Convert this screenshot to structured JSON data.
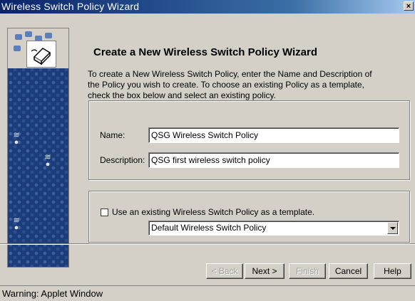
{
  "window": {
    "title": "Wireless Switch Policy Wizard",
    "close_label": "×"
  },
  "wizard": {
    "heading": "Create a New Wireless Switch Policy Wizard",
    "intro_line1": "To create a New Wireless Switch Policy, enter the Name and Description of",
    "intro_line2": "the Policy you wish to create.  To choose an existing Policy as a template,",
    "intro_line3": "check the box below and select an existing policy."
  },
  "form": {
    "name_label": "Name:",
    "name_value": "QSG Wireless Switch Policy",
    "description_label": "Description:",
    "description_value": "QSG first wireless switch policy",
    "template_checkbox_label": "Use an existing Wireless Switch Policy as a template.",
    "template_checked": false,
    "template_select_value": "Default Wireless Switch Policy"
  },
  "buttons": {
    "back": "< Back",
    "next": "Next >",
    "finish": "Finish",
    "cancel": "Cancel",
    "help": "Help"
  },
  "status": {
    "text": "Warning: Applet Window"
  },
  "colors": {
    "title_bar": "#0a246a",
    "sidebar": "#1c3d7a",
    "window_bg": "#d4d0c8"
  },
  "icons": {
    "wizard_icon": "network-switch-icon",
    "sidebar_icons": "wireless-signal-icon"
  }
}
